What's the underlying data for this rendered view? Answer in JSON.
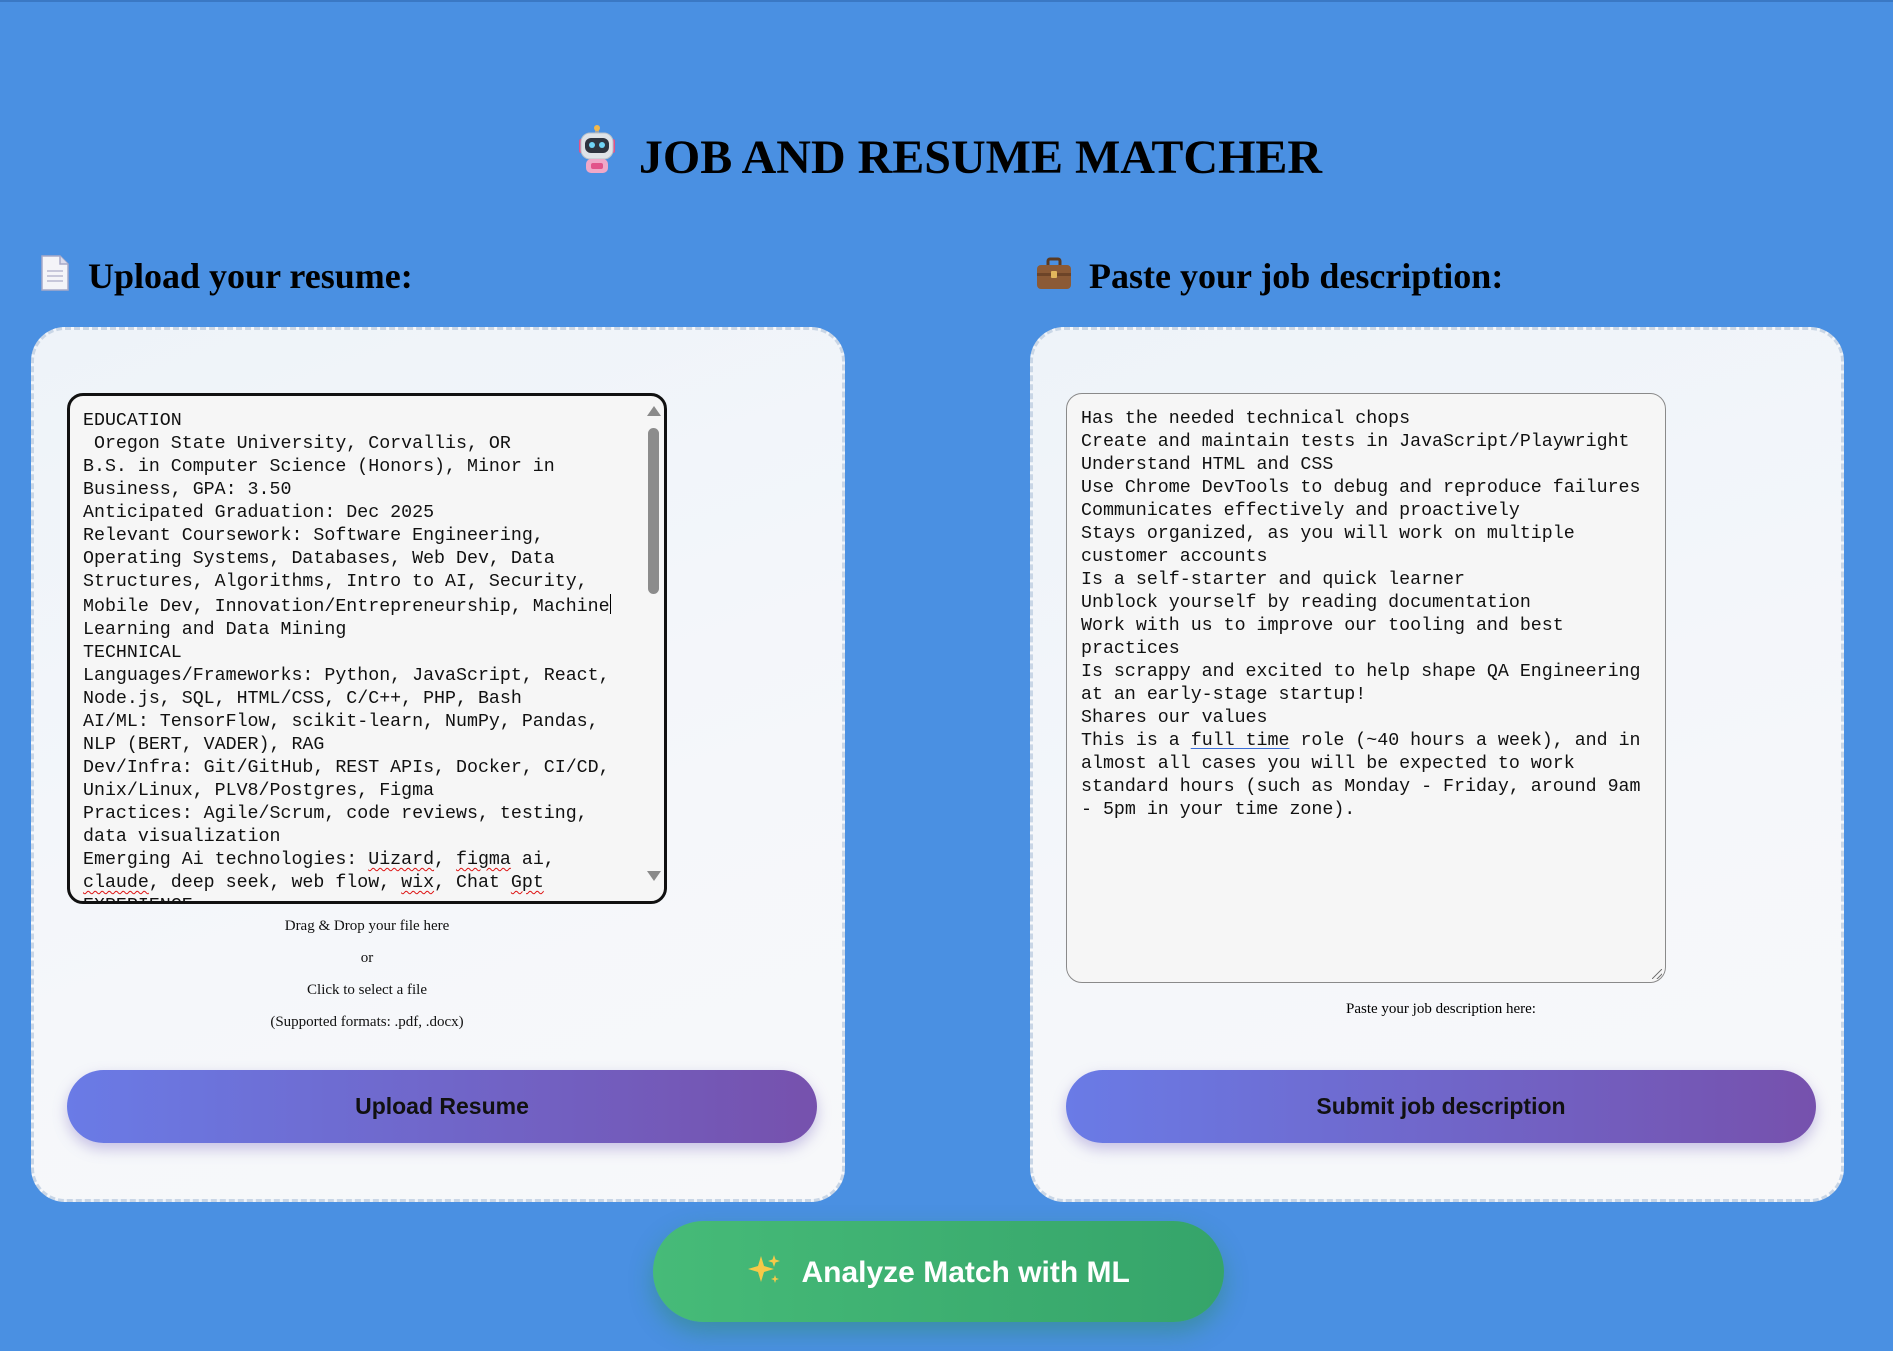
{
  "header": {
    "title": "JOB AND RESUME MATCHER",
    "icon": "robot-icon"
  },
  "resume_section": {
    "heading": "Upload your resume:",
    "icon": "page-document-icon",
    "textarea_lines": [
      "EDUCATION",
      " Oregon State University, Corvallis, OR",
      "B.S. in Computer Science (Honors), Minor in",
      "Business, GPA: 3.50",
      "Anticipated Graduation: Dec 2025",
      "Relevant Coursework: Software Engineering,",
      "Operating Systems, Databases, Web Dev, Data",
      "Structures, Algorithms, Intro to AI, Security,",
      "Mobile Dev, Innovation/Entrepreneurship, Machine",
      "Learning and Data Mining",
      "TECHNICAL",
      "Languages/Frameworks: Python, JavaScript, React,",
      "Node.js, SQL, HTML/CSS, C/C++, PHP, Bash",
      "AI/ML: TensorFlow, scikit-learn, NumPy, Pandas,",
      "NLP (BERT, VADER), RAG",
      "Dev/Infra: Git/GitHub, REST APIs, Docker, CI/CD,",
      "Unix/Linux, PLV8/Postgres, Figma",
      "Practices: Agile/Scrum, code reviews, testing,",
      "data visualization",
      "Emerging Ai technologies: Uizard, figma ai,",
      "claude, deep seek, web flow, wix, Chat Gpt",
      "EXPERIENCE"
    ],
    "drop_text": "Drag & Drop your file here",
    "or_text": "or",
    "click_text": "Click to select a file",
    "formats_text": "(Supported formats: .pdf, .docx)",
    "button_label": "Upload Resume"
  },
  "job_section": {
    "heading": "Paste your job description:",
    "icon": "briefcase-icon",
    "textarea_lines": [
      "Has the needed technical chops",
      "Create and maintain tests in JavaScript/Playwright",
      "Understand HTML and CSS",
      "Use Chrome DevTools to debug and reproduce failures",
      "Communicates effectively and proactively",
      "Stays organized, as you will work on multiple",
      "customer accounts",
      "Is a self-starter and quick learner",
      "Unblock yourself by reading documentation",
      "Work with us to improve our tooling and best",
      "practices",
      "Is scrappy and excited to help shape QA Engineering",
      "at an early-stage startup!",
      "Shares our values",
      "This is a full time role (~40 hours a week), and in",
      "almost all cases you will be expected to work",
      "standard hours (such as Monday - Friday, around 9am",
      "- 5pm in your time zone)."
    ],
    "caption": "Paste your job description here:",
    "button_label": "Submit job description"
  },
  "analyze": {
    "icon": "sparkles-icon",
    "label": "Analyze Match with ML"
  },
  "colors": {
    "background": "#4a90e2",
    "button_gradient_start": "#6a7be6",
    "button_gradient_end": "#7651ad",
    "analyze_green": "#42b573"
  }
}
